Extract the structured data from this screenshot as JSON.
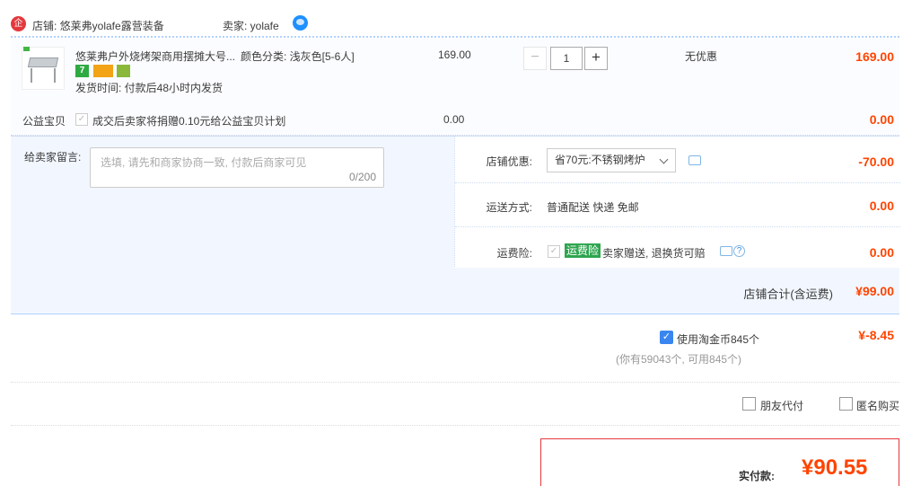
{
  "shop": {
    "logo_glyph": "企",
    "shop_label": "店铺: 悠莱弗yolafe露营装备",
    "seller_label": "卖家: yolafe"
  },
  "item": {
    "title": "悠莱弗户外烧烤架商用摆摊大号...",
    "sku": "颜色分类: 浅灰色[5-6人]",
    "badges": [
      "7",
      "",
      ""
    ],
    "ship_time": "发货时间: 付款后48小时内发货",
    "unit_price": "169.00",
    "qty_minus": "−",
    "qty": "1",
    "qty_plus": "+",
    "promo": "无优惠",
    "subtotal": "169.00"
  },
  "charity": {
    "label": "公益宝贝",
    "text": "成交后卖家将捐赠0.10元给公益宝贝计划",
    "price": "0.00",
    "subtotal": "0.00"
  },
  "memo": {
    "label": "给卖家留言:",
    "placeholder": "选填, 请先和商家协商一致, 付款后商家可见",
    "count": "0/200"
  },
  "coupon": {
    "label": "店铺优惠:",
    "selected": "省70元:不锈钢烤炉",
    "amount": "-70.00"
  },
  "shipping": {
    "label": "运送方式:",
    "value": "普通配送 快递 免邮",
    "amount": "0.00"
  },
  "insurance": {
    "label": "运费险:",
    "badge": "运费险",
    "text": "卖家赠送, 退换货可赔",
    "help": "?",
    "amount": "0.00"
  },
  "shop_total": {
    "label": "店铺合计(含运费)",
    "amount": "¥99.00"
  },
  "coins": {
    "checkbox": "✓",
    "label": "使用淘金币845个",
    "amount": "¥-8.45",
    "note": "(你有59043个, 可用845个)"
  },
  "extras": {
    "friend_pay": "朋友代付",
    "anonymous": "匿名购买"
  },
  "final": {
    "label": "实付款:",
    "amount": "¥90.55"
  },
  "colors": {
    "accent_red": "#ff4400",
    "border_blue": "#b2d1ff",
    "panel_blue": "#f2f7ff",
    "checkbox_blue": "#3a86f0"
  }
}
